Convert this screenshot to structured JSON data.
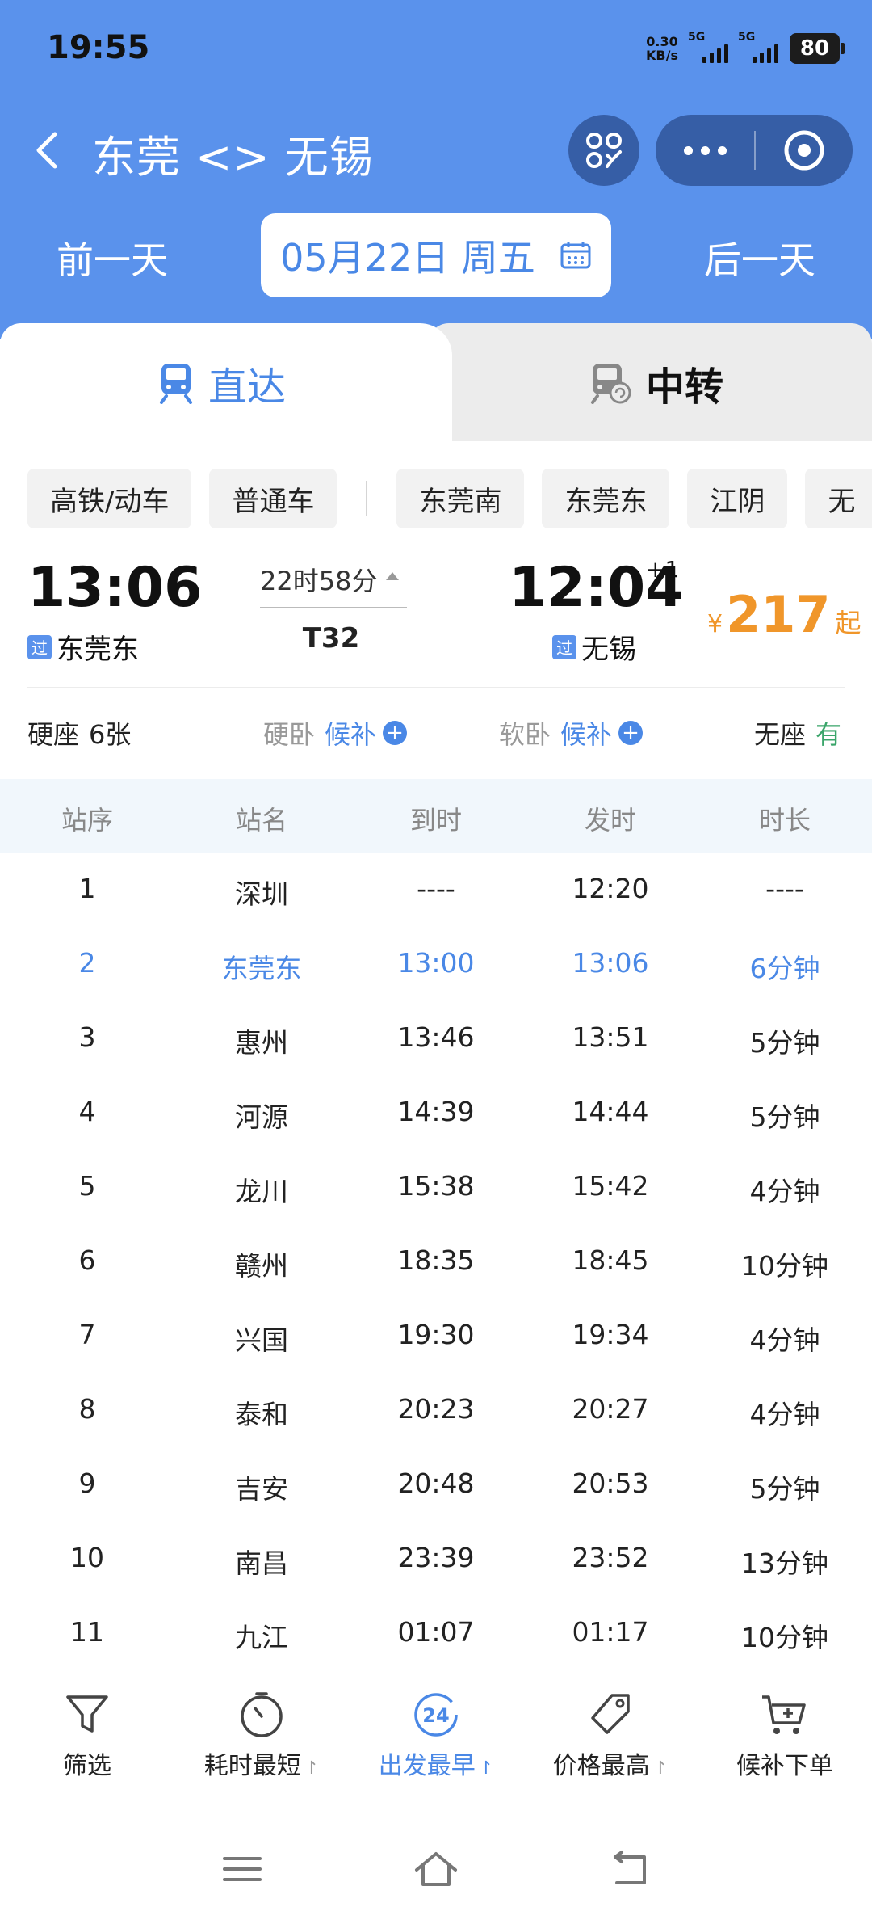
{
  "status_bar": {
    "time": "19:55",
    "net_speed_value": "0.30",
    "net_speed_unit": "KB/s",
    "signal1_label": "5G",
    "signal2_label": "5G",
    "battery": "80"
  },
  "header": {
    "route_title": "东莞 <> 无锡",
    "prev_day": "前一天",
    "next_day": "后一天",
    "date": "05月22日 周五"
  },
  "tabs": {
    "direct": "直达",
    "transfer": "中转"
  },
  "filters": {
    "type_chips": [
      "高铁/动车",
      "普通车"
    ],
    "station_chips": [
      "东莞南",
      "东莞东",
      "江阴",
      "无"
    ]
  },
  "train": {
    "departure_time": "13:06",
    "departure_station": "东莞东",
    "departure_badge": "过",
    "arrival_time": "12:04",
    "arrival_day_offset": "+1",
    "arrival_station": "无锡",
    "arrival_badge": "过",
    "duration": "22时58分",
    "train_number": "T32",
    "price_currency": "¥",
    "price": "217",
    "price_suffix": "起"
  },
  "seats": [
    {
      "name": "硬座",
      "status": "6张"
    },
    {
      "name": "硬卧",
      "status": "候补"
    },
    {
      "name": "软卧",
      "status": "候补"
    },
    {
      "name": "无座",
      "status": "有"
    }
  ],
  "stop_table": {
    "headers": [
      "站序",
      "站名",
      "到时",
      "发时",
      "时长"
    ],
    "rows": [
      [
        "1",
        "深圳",
        "----",
        "12:20",
        "----"
      ],
      [
        "2",
        "东莞东",
        "13:00",
        "13:06",
        "6分钟"
      ],
      [
        "3",
        "惠州",
        "13:46",
        "13:51",
        "5分钟"
      ],
      [
        "4",
        "河源",
        "14:39",
        "14:44",
        "5分钟"
      ],
      [
        "5",
        "龙川",
        "15:38",
        "15:42",
        "4分钟"
      ],
      [
        "6",
        "赣州",
        "18:35",
        "18:45",
        "10分钟"
      ],
      [
        "7",
        "兴国",
        "19:30",
        "19:34",
        "4分钟"
      ],
      [
        "8",
        "泰和",
        "20:23",
        "20:27",
        "4分钟"
      ],
      [
        "9",
        "吉安",
        "20:48",
        "20:53",
        "5分钟"
      ],
      [
        "10",
        "南昌",
        "23:39",
        "23:52",
        "13分钟"
      ],
      [
        "11",
        "九江",
        "01:07",
        "01:17",
        "10分钟"
      ]
    ],
    "current_row": 2
  },
  "toolbar": {
    "filter": "筛选",
    "shortest": "耗时最短",
    "earliest": "出发最早",
    "price_high": "价格最高",
    "waitlist": "候补下单",
    "clock_badge": "24"
  },
  "colors": {
    "header_blue": "#5a92ec",
    "accent_blue": "#4a88e6",
    "price_orange": "#f0962a",
    "available_green": "#3aa56a"
  },
  "icons": {
    "back": "back-arrow-icon",
    "scan": "scan-icon",
    "more": "more-dots-icon",
    "close": "target-close-icon",
    "calendar": "calendar-icon",
    "train": "train-icon",
    "transfer_train": "transfer-train-icon",
    "funnel": "funnel-icon",
    "timer": "timer-icon",
    "clock24": "clock-24-icon",
    "tag": "price-tag-icon",
    "cart": "cart-plus-icon"
  }
}
